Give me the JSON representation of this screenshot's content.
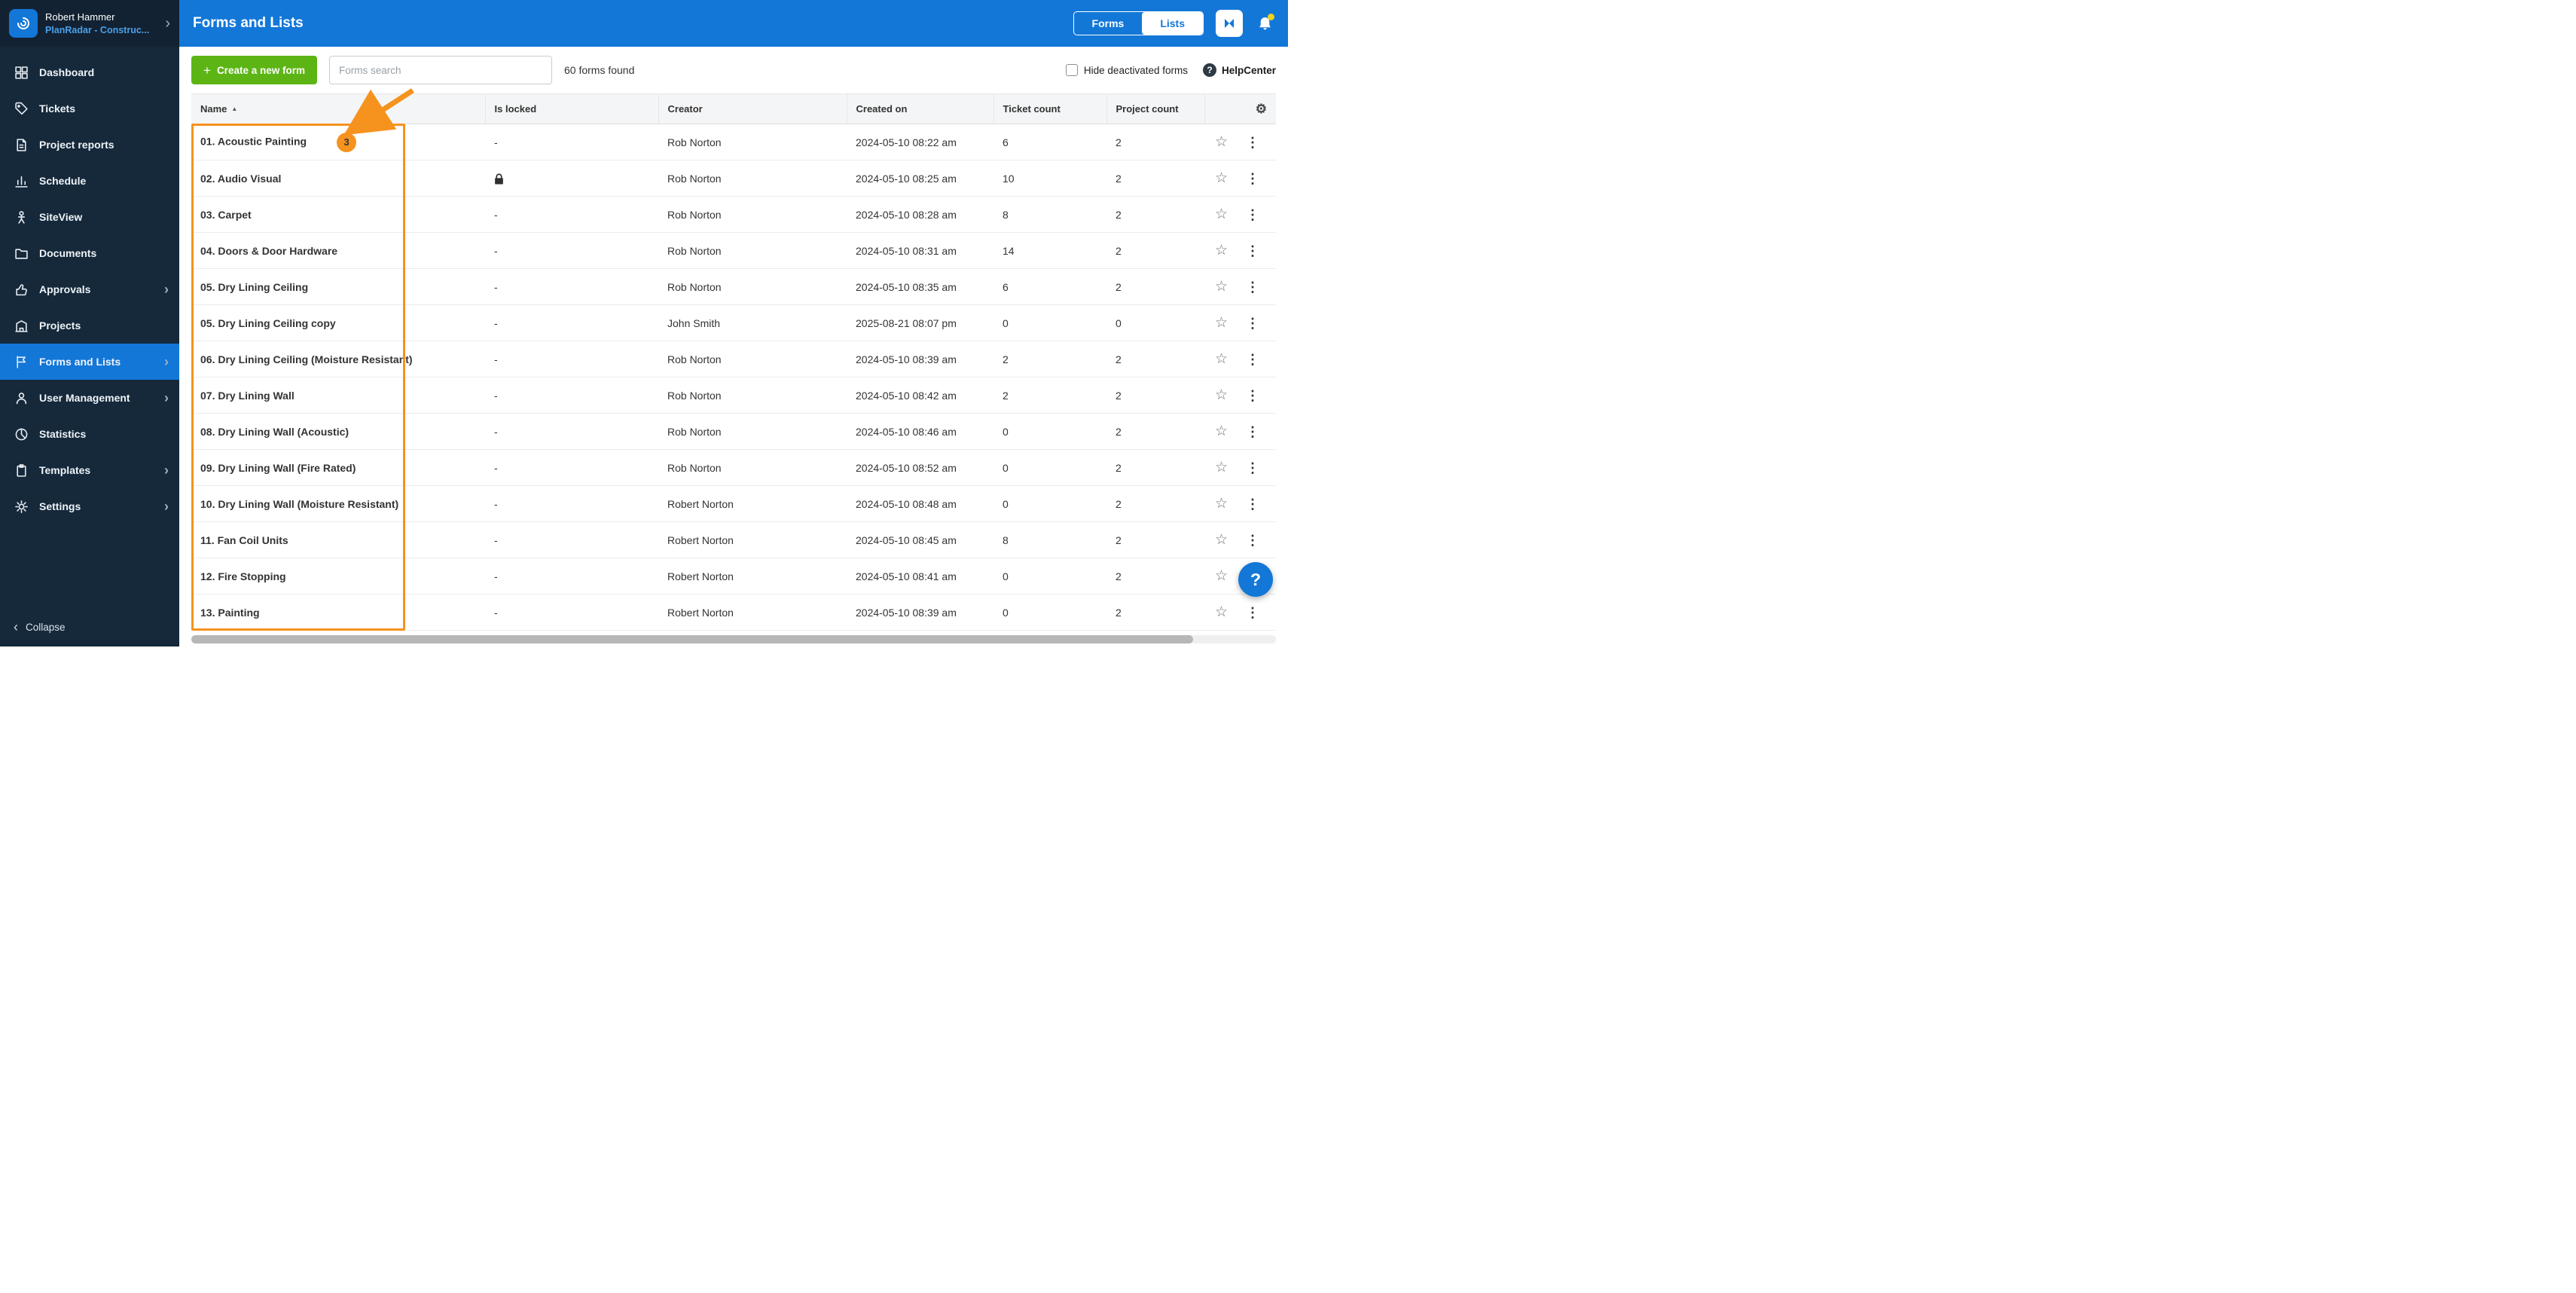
{
  "sidebar": {
    "user": {
      "name": "Robert Hammer",
      "account": "PlanRadar - Construc..."
    },
    "items": [
      {
        "label": "Dashboard",
        "icon": "dashboard-icon",
        "chevron": false,
        "active": false
      },
      {
        "label": "Tickets",
        "icon": "tickets-icon",
        "chevron": false,
        "active": false
      },
      {
        "label": "Project reports",
        "icon": "project-reports-icon",
        "chevron": false,
        "active": false
      },
      {
        "label": "Schedule",
        "icon": "schedule-icon",
        "chevron": false,
        "active": false
      },
      {
        "label": "SiteView",
        "icon": "siteview-icon",
        "chevron": false,
        "active": false
      },
      {
        "label": "Documents",
        "icon": "documents-icon",
        "chevron": false,
        "active": false
      },
      {
        "label": "Approvals",
        "icon": "approvals-icon",
        "chevron": true,
        "active": false
      },
      {
        "label": "Projects",
        "icon": "projects-icon",
        "chevron": false,
        "active": false
      },
      {
        "label": "Forms and Lists",
        "icon": "forms-icon",
        "chevron": true,
        "active": true
      },
      {
        "label": "User Management",
        "icon": "users-icon",
        "chevron": true,
        "active": false
      },
      {
        "label": "Statistics",
        "icon": "statistics-icon",
        "chevron": false,
        "active": false
      },
      {
        "label": "Templates",
        "icon": "templates-icon",
        "chevron": true,
        "active": false
      },
      {
        "label": "Settings",
        "icon": "settings-icon",
        "chevron": true,
        "active": false
      }
    ],
    "collapse_label": "Collapse"
  },
  "header": {
    "title": "Forms and Lists",
    "toggle": {
      "forms": "Forms",
      "lists": "Lists"
    }
  },
  "toolbar": {
    "create_button": "Create a new form",
    "search_placeholder": "Forms search",
    "results_text": "60 forms found",
    "hide_deactivated_label": "Hide deactivated forms",
    "help_label": "HelpCenter"
  },
  "table": {
    "columns": [
      "Name",
      "Is locked",
      "Creator",
      "Created on",
      "Ticket count",
      "Project count"
    ],
    "rows": [
      {
        "name": "01. Acoustic Painting",
        "badge": "3",
        "locked": "-",
        "creator": "Rob Norton",
        "created": "2024-05-10 08:22 am",
        "tickets": "6",
        "projects": "2"
      },
      {
        "name": "02. Audio Visual",
        "badge": "",
        "locked": "locked",
        "creator": "Rob Norton",
        "created": "2024-05-10 08:25 am",
        "tickets": "10",
        "projects": "2"
      },
      {
        "name": "03. Carpet",
        "badge": "",
        "locked": "-",
        "creator": "Rob Norton",
        "created": "2024-05-10 08:28 am",
        "tickets": "8",
        "projects": "2"
      },
      {
        "name": "04. Doors & Door Hardware",
        "badge": "",
        "locked": "-",
        "creator": "Rob Norton",
        "created": "2024-05-10 08:31 am",
        "tickets": "14",
        "projects": "2"
      },
      {
        "name": "05. Dry Lining Ceiling",
        "badge": "",
        "locked": "-",
        "creator": "Rob Norton",
        "created": "2024-05-10 08:35 am",
        "tickets": "6",
        "projects": "2"
      },
      {
        "name": "05. Dry Lining Ceiling copy",
        "badge": "",
        "locked": "-",
        "creator": "John Smith",
        "created": "2025-08-21 08:07 pm",
        "tickets": "0",
        "projects": "0"
      },
      {
        "name": "06. Dry Lining Ceiling (Moisture Resistant)",
        "badge": "",
        "locked": "-",
        "creator": "Rob Norton",
        "created": "2024-05-10 08:39 am",
        "tickets": "2",
        "projects": "2"
      },
      {
        "name": "07. Dry Lining Wall",
        "badge": "",
        "locked": "-",
        "creator": "Rob Norton",
        "created": "2024-05-10 08:42 am",
        "tickets": "2",
        "projects": "2"
      },
      {
        "name": "08. Dry Lining Wall (Acoustic)",
        "badge": "",
        "locked": "-",
        "creator": "Rob Norton",
        "created": "2024-05-10 08:46 am",
        "tickets": "0",
        "projects": "2"
      },
      {
        "name": "09. Dry Lining Wall (Fire Rated)",
        "badge": "",
        "locked": "-",
        "creator": "Rob Norton",
        "created": "2024-05-10 08:52 am",
        "tickets": "0",
        "projects": "2"
      },
      {
        "name": "10. Dry Lining Wall (Moisture Resistant)",
        "badge": "",
        "locked": "-",
        "creator": "Robert Norton",
        "created": "2024-05-10 08:48 am",
        "tickets": "0",
        "projects": "2"
      },
      {
        "name": "11. Fan Coil Units",
        "badge": "",
        "locked": "-",
        "creator": "Robert Norton",
        "created": "2024-05-10 08:45 am",
        "tickets": "8",
        "projects": "2"
      },
      {
        "name": "12. Fire Stopping",
        "badge": "",
        "locked": "-",
        "creator": "Robert Norton",
        "created": "2024-05-10 08:41 am",
        "tickets": "0",
        "projects": "2"
      },
      {
        "name": "13. Painting",
        "badge": "",
        "locked": "-",
        "creator": "Robert Norton",
        "created": "2024-05-10 08:39 am",
        "tickets": "0",
        "projects": "2"
      }
    ]
  },
  "floating_help": {
    "label": "?"
  },
  "colors": {
    "brand_blue": "#1377d8",
    "sidebar_bg": "#16293b",
    "green_button": "#5cb514",
    "annotation_orange": "#f6921e",
    "notification_dot_yellow": "#f3d11c"
  }
}
